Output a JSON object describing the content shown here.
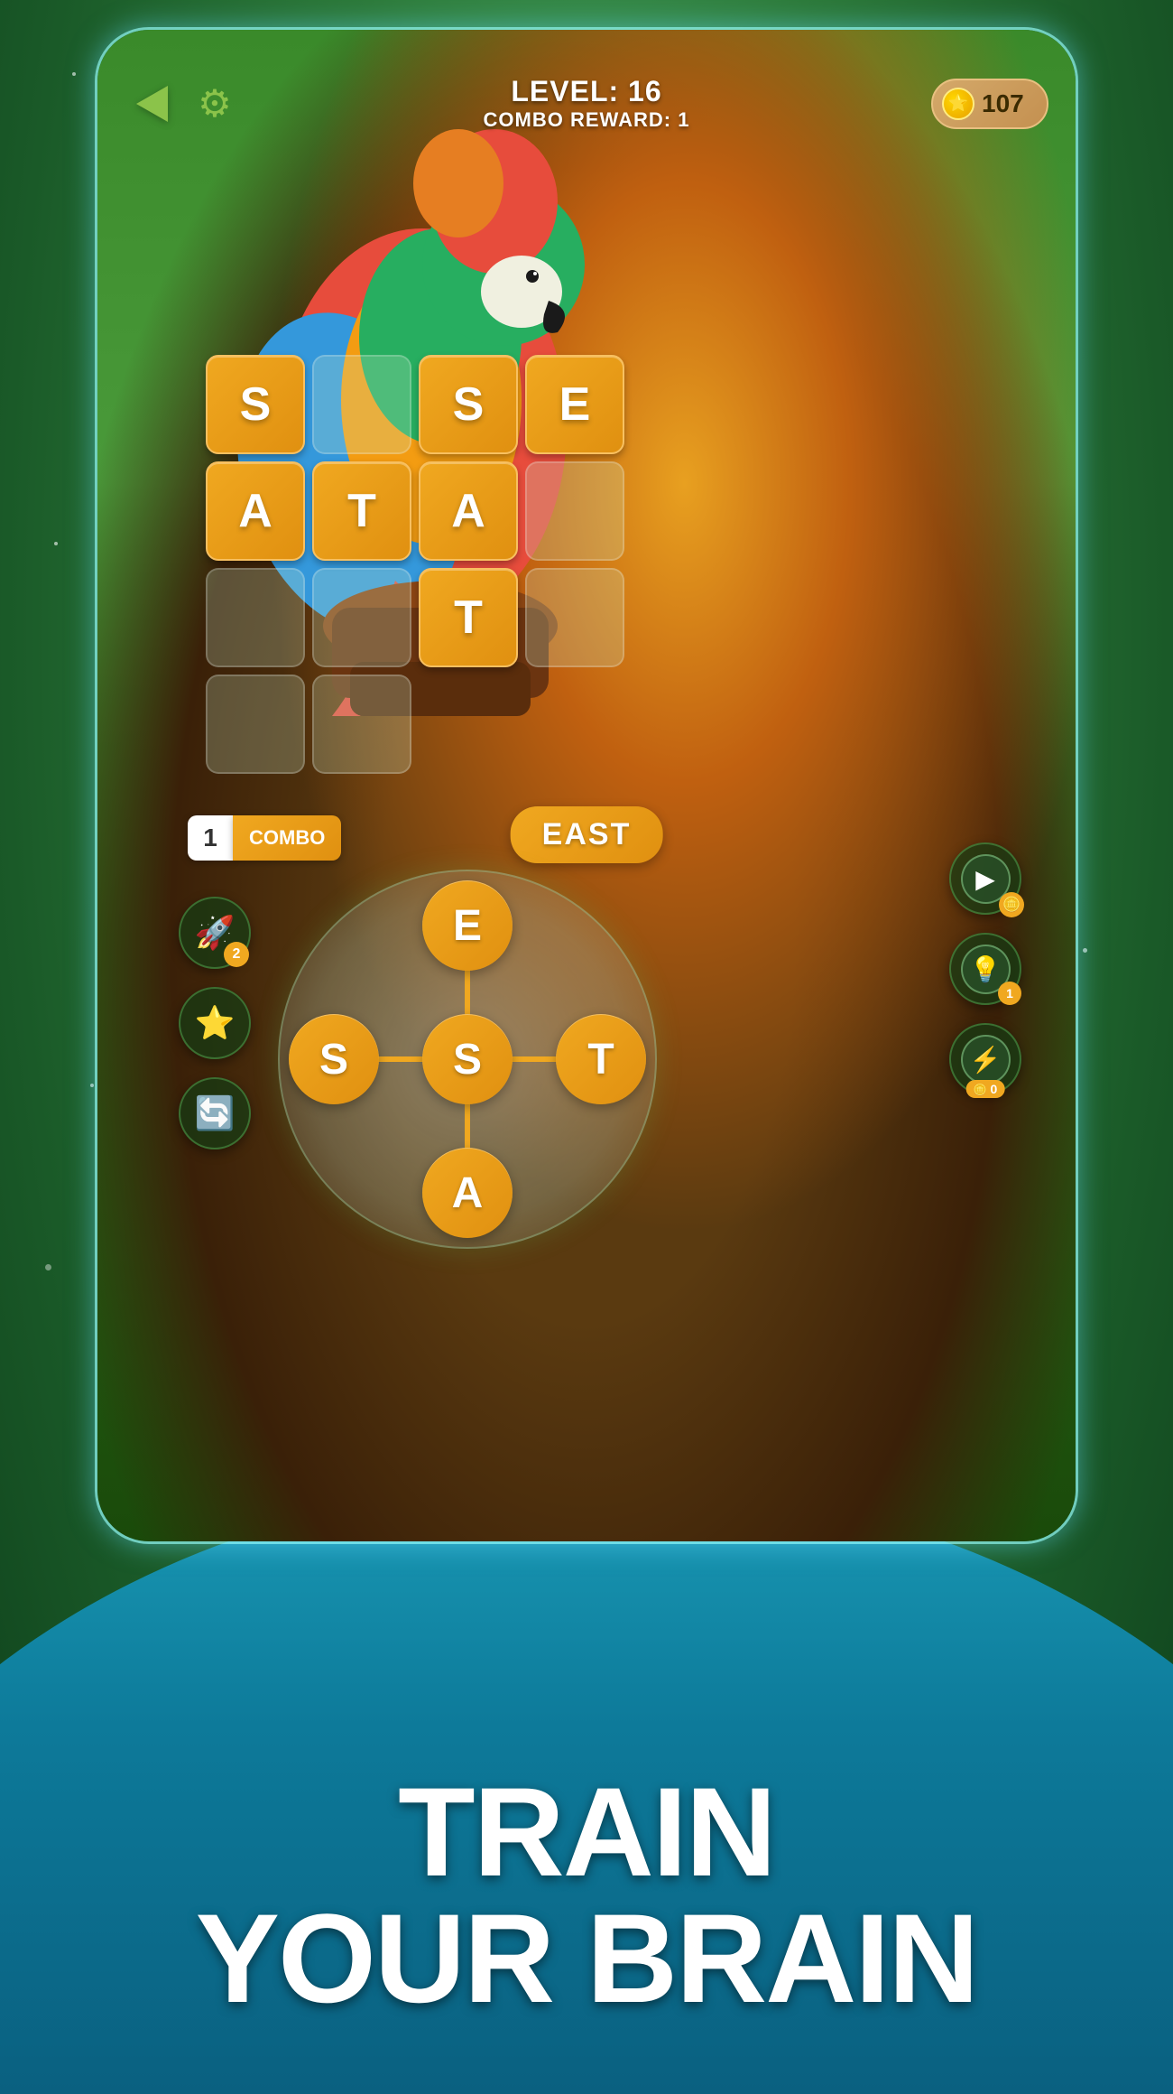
{
  "background": {
    "color": "#2a7a3a"
  },
  "header": {
    "level_label": "LEVEL: 16",
    "combo_reward_label": "COMBO REWARD: 1",
    "coins": "107"
  },
  "grid": {
    "cells": [
      {
        "letter": "S",
        "filled": true,
        "row": 0,
        "col": 0
      },
      {
        "letter": "",
        "filled": false,
        "row": 0,
        "col": 1
      },
      {
        "letter": "S",
        "filled": true,
        "row": 0,
        "col": 2
      },
      {
        "letter": "E",
        "filled": true,
        "row": 0,
        "col": 3
      },
      {
        "letter": "A",
        "filled": true,
        "row": 0,
        "col": 4
      },
      {
        "letter": "T",
        "filled": true,
        "row": 0,
        "col": 5
      },
      {
        "letter": "A",
        "filled": true,
        "row": 1,
        "col": 0
      },
      {
        "letter": "",
        "filled": false,
        "row": 1,
        "col": 1
      },
      {
        "letter": "",
        "filled": false,
        "row": 1,
        "col": 2
      },
      {
        "letter": "",
        "filled": false,
        "row": 1,
        "col": 3
      },
      {
        "letter": "T",
        "filled": true,
        "row": 2,
        "col": 0
      },
      {
        "letter": "",
        "filled": false,
        "row": 2,
        "col": 1
      },
      {
        "letter": "",
        "filled": false,
        "row": 2,
        "col": 2
      },
      {
        "letter": "",
        "filled": false,
        "row": 2,
        "col": 3
      }
    ]
  },
  "combo": {
    "number": "1",
    "label": "COMBO"
  },
  "word_display": {
    "text": "EAST"
  },
  "wheel": {
    "letters": {
      "center": "S",
      "top": "E",
      "bottom": "A",
      "left": "S",
      "right": "T"
    }
  },
  "left_buttons": {
    "rocket": {
      "icon": "🚀",
      "badge": "2"
    },
    "star": {
      "icon": "⭐"
    },
    "refresh": {
      "icon": "🔄"
    }
  },
  "right_buttons": {
    "video": {
      "icon": "▶"
    },
    "hint": {
      "icon": "💡",
      "badge": "1"
    },
    "lightning": {
      "icon": "⚡",
      "badge": "0"
    }
  },
  "tagline": {
    "line1": "TRAIN",
    "line2": "YOUR BRAIN"
  }
}
